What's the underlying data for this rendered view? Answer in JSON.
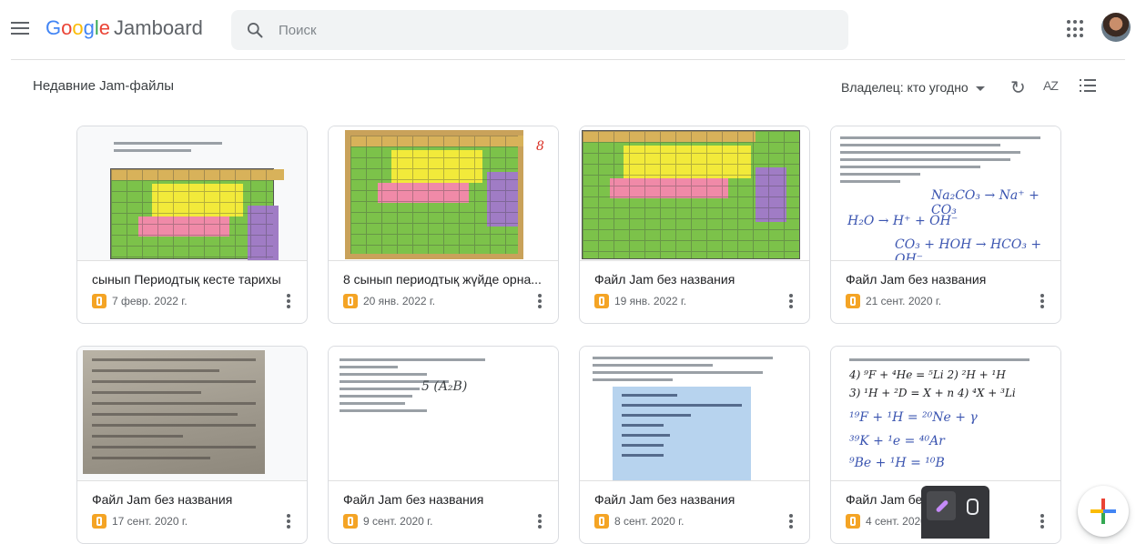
{
  "app": {
    "logo_google": [
      "G",
      "o",
      "o",
      "g",
      "l",
      "e"
    ],
    "product_name": "Jamboard",
    "menu_icon": "hamburger-icon",
    "apps_icon": "apps-grid-icon",
    "avatar_icon": "user-avatar"
  },
  "search": {
    "placeholder": "Поиск",
    "icon": "search-icon"
  },
  "section": {
    "title": "Недавние Jam-файлы"
  },
  "toolbar": {
    "owner_filter": "Владелец: кто угодно",
    "refresh_icon": "refresh-icon",
    "sort_label": "AZ",
    "view_icon": "list-view-icon"
  },
  "cards": [
    {
      "title": "сынып Периодтық кесте тарихы",
      "date": "7 февр. 2022 г."
    },
    {
      "title": "8 сынып периодтық жүйде орна...",
      "date": "20 янв. 2022 г."
    },
    {
      "title": "Файл Jam без названия",
      "date": "19 янв. 2022 г."
    },
    {
      "title": "Файл Jam без названия",
      "date": "21 сент. 2020 г."
    },
    {
      "title": "Файл Jam без названия",
      "date": "17 сент. 2020 г."
    },
    {
      "title": "Файл Jam без названия",
      "date": "9 сент. 2020 г."
    },
    {
      "title": "Файл Jam без названия",
      "date": "8 сент. 2020 г."
    },
    {
      "title": "Файл Jam без названия",
      "date": "4 сент. 2020 г."
    }
  ],
  "colors": {
    "jam_icon": "#f4a425",
    "fab_red": "#ea4335",
    "fab_yellow": "#fbbc05",
    "fab_green": "#34a853",
    "fab_blue": "#4285f4",
    "pen_purple": "#c58af9"
  }
}
